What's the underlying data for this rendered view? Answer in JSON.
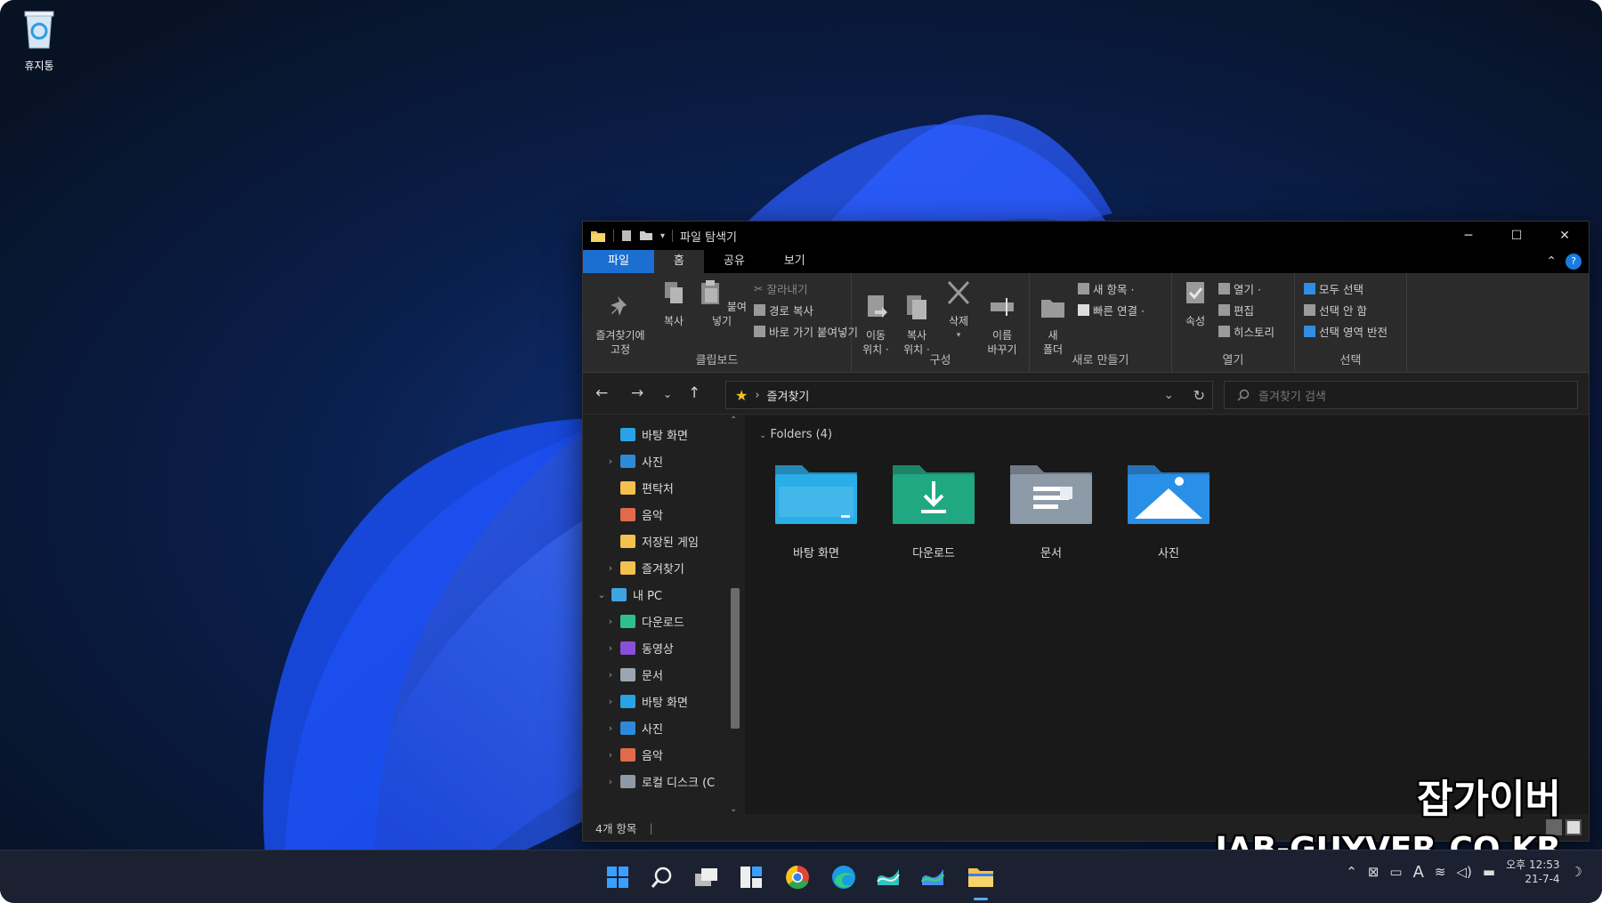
{
  "desktop": {
    "recycle_bin_label": "휴지통"
  },
  "window": {
    "title": "파일 탐색기",
    "controls": {
      "minimize": "─",
      "maximize": "☐",
      "close": "✕"
    }
  },
  "ribbon_tabs": [
    "파일",
    "홈",
    "공유",
    "보기"
  ],
  "ribbon": {
    "clipboard": {
      "label": "클립보드",
      "pin": "즐겨찾기에\n고정",
      "copy": "복사",
      "paste": "붙여넣기",
      "cut": "잘라내기",
      "copy_path": "경로 복사",
      "paste_shortcut": "바로 가기 붙여넣기"
    },
    "organize": {
      "label": "구성",
      "move_to": "이동\n위치 ·",
      "copy_to": "복사\n위치 ·",
      "delete": "삭제",
      "rename": "이름\n바꾸기"
    },
    "new": {
      "label": "새로 만들기",
      "new_folder": "새\n폴더",
      "new_item": "새 항목 ·",
      "easy_access": "빠른 연결 ·"
    },
    "open": {
      "label": "열기",
      "properties": "속성",
      "open": "열기 ·",
      "edit": "편집",
      "history": "히스토리"
    },
    "select": {
      "label": "선택",
      "select_all": "모두 선택",
      "select_none": "선택 안 함",
      "invert": "선택 영역 반전"
    }
  },
  "address": {
    "path": "즐겨찾기",
    "search_placeholder": "즐겨찾기 검색"
  },
  "nav_pane": [
    {
      "label": "바탕 화면",
      "arrow": "",
      "color": "#29a3e6"
    },
    {
      "label": "사진",
      "arrow": "›",
      "color": "#2e8ad8"
    },
    {
      "label": "편탁처",
      "arrow": "",
      "color": "#f2c14e"
    },
    {
      "label": "음악",
      "arrow": "",
      "color": "#e06a4a"
    },
    {
      "label": "저장된 게임",
      "arrow": "",
      "color": "#f2c14e"
    },
    {
      "label": "즐겨찾기",
      "arrow": "›",
      "color": "#f2c14e"
    },
    {
      "label": "내 PC",
      "arrow": "⌄",
      "color": "#3fa3e0"
    },
    {
      "label": "다운로드",
      "arrow": "›",
      "color": "#2fbf8f"
    },
    {
      "label": "동영상",
      "arrow": "›",
      "color": "#8a4fd8"
    },
    {
      "label": "문서",
      "arrow": "›",
      "color": "#9aa6b2"
    },
    {
      "label": "바탕 화면",
      "arrow": "›",
      "color": "#29a3e6"
    },
    {
      "label": "사진",
      "arrow": "›",
      "color": "#2e8ad8"
    },
    {
      "label": "음악",
      "arrow": "›",
      "color": "#e06a4a"
    },
    {
      "label": "로컬 디스크 (C",
      "arrow": "›",
      "color": "#8e9aa6"
    }
  ],
  "content": {
    "group_header": "Folders (4)",
    "folders": [
      {
        "label": "바탕 화면",
        "icon": "desktop-folder-icon",
        "color": "#2aaee8"
      },
      {
        "label": "다운로드",
        "icon": "downloads-folder-icon",
        "color": "#1fa882"
      },
      {
        "label": "문서",
        "icon": "documents-folder-icon",
        "color": "#8d9aa8"
      },
      {
        "label": "사진",
        "icon": "pictures-folder-icon",
        "color": "#2a8fe6"
      }
    ]
  },
  "status_bar": {
    "item_count": "4개 항목",
    "divider": "|"
  },
  "tray": {
    "time": "오후 12:53",
    "date": "21-7-4",
    "ime": "A"
  },
  "watermark": {
    "korean": "잡가이버",
    "english": "JAB-GUYVER.CO.KR"
  }
}
